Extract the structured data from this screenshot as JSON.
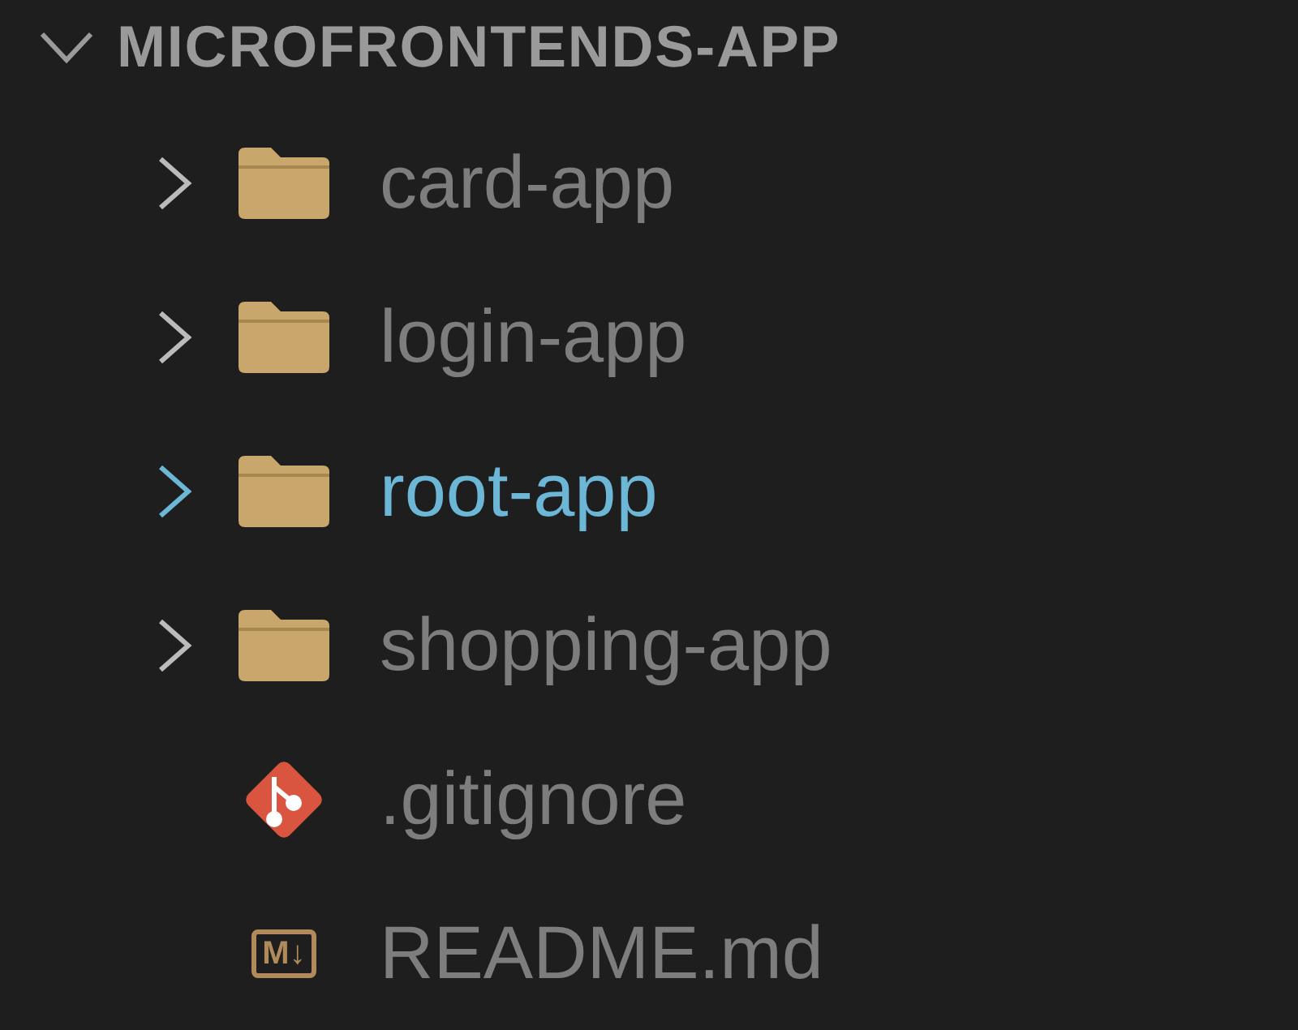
{
  "explorer": {
    "title": "MICROFRONTENDS-APP",
    "expanded": true
  },
  "items": [
    {
      "name": "card-app",
      "kind": "folder",
      "expanded": false,
      "selected": false
    },
    {
      "name": "login-app",
      "kind": "folder",
      "expanded": false,
      "selected": false
    },
    {
      "name": "root-app",
      "kind": "folder",
      "expanded": false,
      "selected": true
    },
    {
      "name": "shopping-app",
      "kind": "folder",
      "expanded": false,
      "selected": false
    },
    {
      "name": ".gitignore",
      "kind": "git",
      "selected": false
    },
    {
      "name": "README.md",
      "kind": "markdown",
      "icon_text": "M↓",
      "selected": false
    }
  ]
}
